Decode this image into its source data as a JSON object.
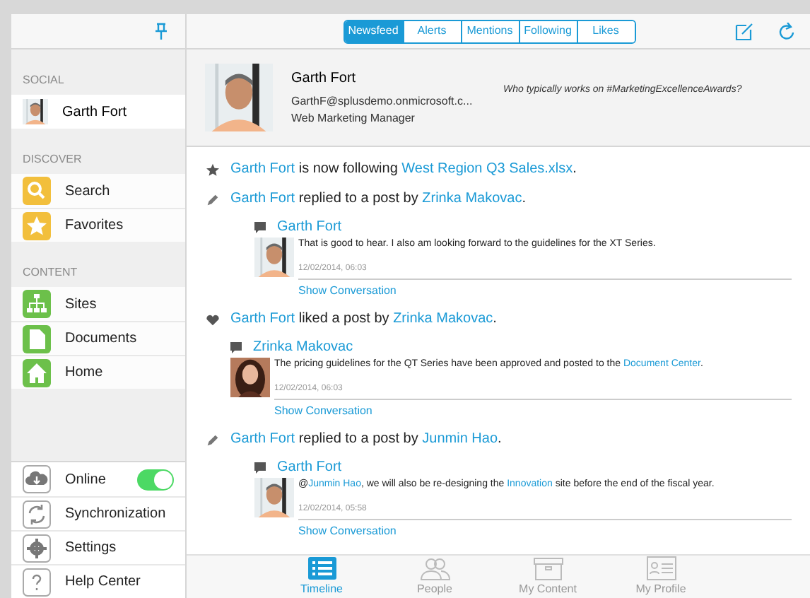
{
  "top_tabs": [
    {
      "label": "Newsfeed",
      "selected": true
    },
    {
      "label": "Alerts",
      "selected": false
    },
    {
      "label": "Mentions",
      "selected": false
    },
    {
      "label": "Following",
      "selected": false
    },
    {
      "label": "Likes",
      "selected": false
    }
  ],
  "sidebar": {
    "sections": [
      {
        "title": "SOCIAL",
        "items": [
          {
            "label": "Garth Fort",
            "selected": true
          }
        ]
      },
      {
        "title": "DISCOVER",
        "items": [
          {
            "label": "Search",
            "selected": false
          },
          {
            "label": "Favorites",
            "selected": false
          }
        ]
      },
      {
        "title": "CONTENT",
        "items": [
          {
            "label": "Sites",
            "selected": false
          },
          {
            "label": "Documents",
            "selected": false
          },
          {
            "label": "Home",
            "selected": false
          }
        ]
      }
    ],
    "settings": [
      {
        "label": "Online",
        "kind": "toggle",
        "on": true
      },
      {
        "label": "Synchronization",
        "kind": "link"
      },
      {
        "label": "Settings",
        "kind": "link"
      },
      {
        "label": "Help Center",
        "kind": "link"
      }
    ]
  },
  "profile": {
    "name": "Garth Fort",
    "email": "GarthF@splusdemo.onmicrosoft.c...",
    "title": "Web Marketing Manager",
    "question": "Who typically works on #MarketingExcellenceAwards?"
  },
  "feed": [
    {
      "kind": "follow",
      "parts": [
        {
          "text": "Garth Fort",
          "link": true
        },
        {
          "text": " is now following ",
          "link": false
        },
        {
          "text": "West Region Q3 Sales.xlsx",
          "link": true
        },
        {
          "text": ".",
          "link": false
        }
      ]
    },
    {
      "kind": "reply",
      "parts": [
        {
          "text": "Garth Fort",
          "link": true
        },
        {
          "text": " replied to a post by ",
          "link": false
        },
        {
          "text": "Zrinka Makovac",
          "link": true
        },
        {
          "text": ".",
          "link": false
        }
      ],
      "post": {
        "author": "Garth Fort",
        "body": [
          {
            "text": "That is good to hear. I also am looking forward to the guidelines for the XT Series.",
            "link": false
          }
        ],
        "time": "12/02/2014, 06:03",
        "action": "Show Conversation"
      }
    },
    {
      "kind": "like",
      "parts": [
        {
          "text": "Garth Fort",
          "link": true
        },
        {
          "text": " liked a post by ",
          "link": false
        },
        {
          "text": "Zrinka Makovac",
          "link": true
        },
        {
          "text": ".",
          "link": false
        }
      ],
      "post": {
        "author": "Zrinka Makovac",
        "body": [
          {
            "text": "The pricing guidelines for the QT Series have been approved and posted to the ",
            "link": false
          },
          {
            "text": "Document Center",
            "link": true
          },
          {
            "text": ".",
            "link": false
          }
        ],
        "time": "12/02/2014, 06:03",
        "action": "Show Conversation"
      }
    },
    {
      "kind": "reply",
      "parts": [
        {
          "text": "Garth Fort",
          "link": true
        },
        {
          "text": " replied to a post by ",
          "link": false
        },
        {
          "text": "Junmin Hao",
          "link": true
        },
        {
          "text": ".",
          "link": false
        }
      ],
      "post": {
        "author": "Garth Fort",
        "body": [
          {
            "text": "@",
            "link": false
          },
          {
            "text": "Junmin Hao",
            "link": true
          },
          {
            "text": ", we will also be re-designing the ",
            "link": false
          },
          {
            "text": "Innovation",
            "link": true
          },
          {
            "text": " site before the end of the fiscal year.",
            "link": false
          }
        ],
        "time": "12/02/2014, 05:58",
        "action": "Show Conversation"
      }
    }
  ],
  "bottom_tabs": [
    {
      "label": "Timeline",
      "selected": true
    },
    {
      "label": "People",
      "selected": false
    },
    {
      "label": "My Content",
      "selected": false
    },
    {
      "label": "My Profile",
      "selected": false
    }
  ]
}
